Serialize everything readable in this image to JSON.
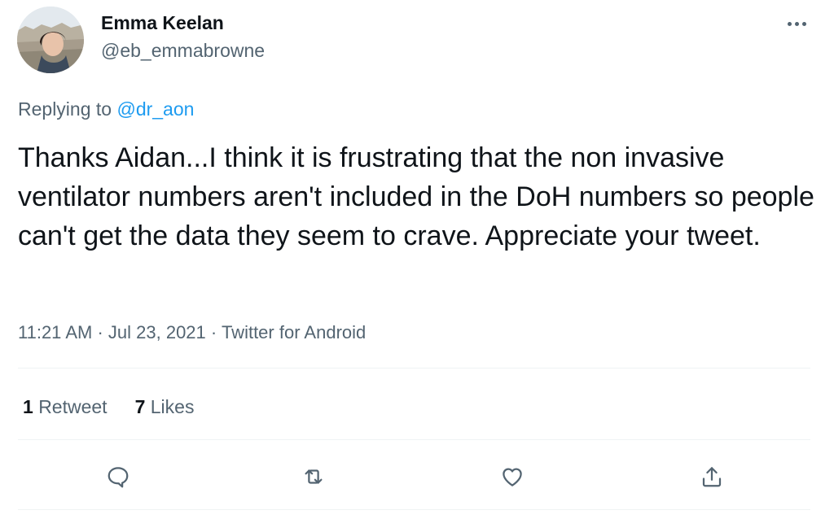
{
  "author": {
    "name": "Emma Keelan",
    "handle": "@eb_emmabrowne"
  },
  "reply": {
    "prefix": "Replying to",
    "to": "@dr_aon"
  },
  "tweet": {
    "text": "Thanks Aidan...I think it is frustrating that the non invasive ventilator numbers aren't included in the DoH numbers so people can't get the data they seem to crave. Appreciate your tweet.",
    "time": "11:21 AM",
    "separator": "·",
    "date": "Jul 23, 2021",
    "source": "Twitter for Android"
  },
  "stats": {
    "retweets_count": "1",
    "retweets_label": "Retweet",
    "likes_count": "7",
    "likes_label": "Likes"
  },
  "actions": [
    "reply-icon",
    "retweet-icon",
    "like-icon",
    "share-icon"
  ],
  "colors": {
    "text": "#0f1419",
    "secondary": "#536471",
    "link": "#1d9bf0",
    "divider": "#eff3f4"
  }
}
